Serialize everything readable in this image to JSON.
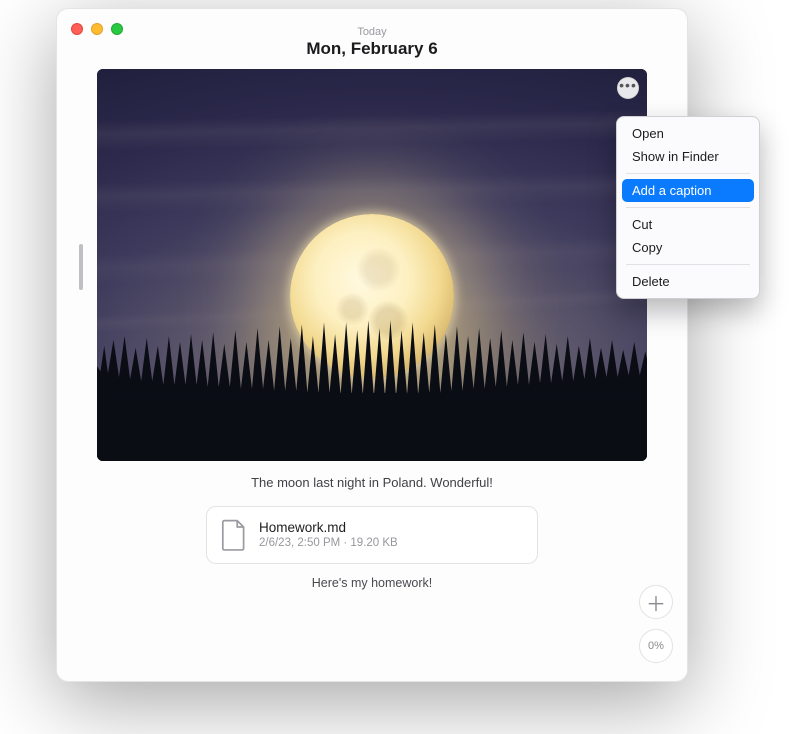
{
  "header": {
    "subtitle": "Today",
    "title": "Mon, February 6"
  },
  "photo": {
    "caption": "The moon last night in Poland. Wonderful!",
    "more_button_icon": "ellipsis-icon"
  },
  "attachment": {
    "name": "Homework.md",
    "meta": "2/6/23, 2:50 PM · 19.20 KB",
    "caption": "Here's my homework!"
  },
  "side": {
    "add_icon": "plus-icon",
    "zoom_label": "0%"
  },
  "context_menu": {
    "items": [
      {
        "label": "Open",
        "selected": false
      },
      {
        "label": "Show in Finder",
        "selected": false
      }
    ],
    "items2": [
      {
        "label": "Add a caption",
        "selected": true
      }
    ],
    "items3": [
      {
        "label": "Cut",
        "selected": false
      },
      {
        "label": "Copy",
        "selected": false
      }
    ],
    "items4": [
      {
        "label": "Delete",
        "selected": false
      }
    ]
  }
}
